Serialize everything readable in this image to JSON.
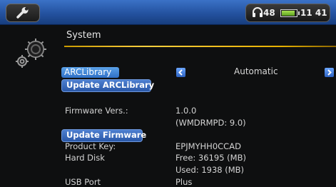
{
  "statusbar": {
    "volume": "48",
    "time": "11 41",
    "battery_level": 0.9
  },
  "page": {
    "title": "System"
  },
  "arclibrary": {
    "label": "ARCLibrary",
    "value": "Automatic",
    "update_button": "Update ARCLibrary"
  },
  "firmware": {
    "label": "Firmware Vers.:",
    "value": "1.0.0",
    "value2": "(WMDRMPD: 9.0)",
    "update_button": "Update Firmware"
  },
  "product_key": {
    "label": "Product Key:",
    "value": "EPJMYHH0CCAD"
  },
  "hard_disk": {
    "label": "Hard Disk",
    "free": "Free: 36195 (MB)",
    "used": "Used:  1938 (MB)"
  },
  "usb_port": {
    "label": "USB Port",
    "value": "Plus"
  }
}
